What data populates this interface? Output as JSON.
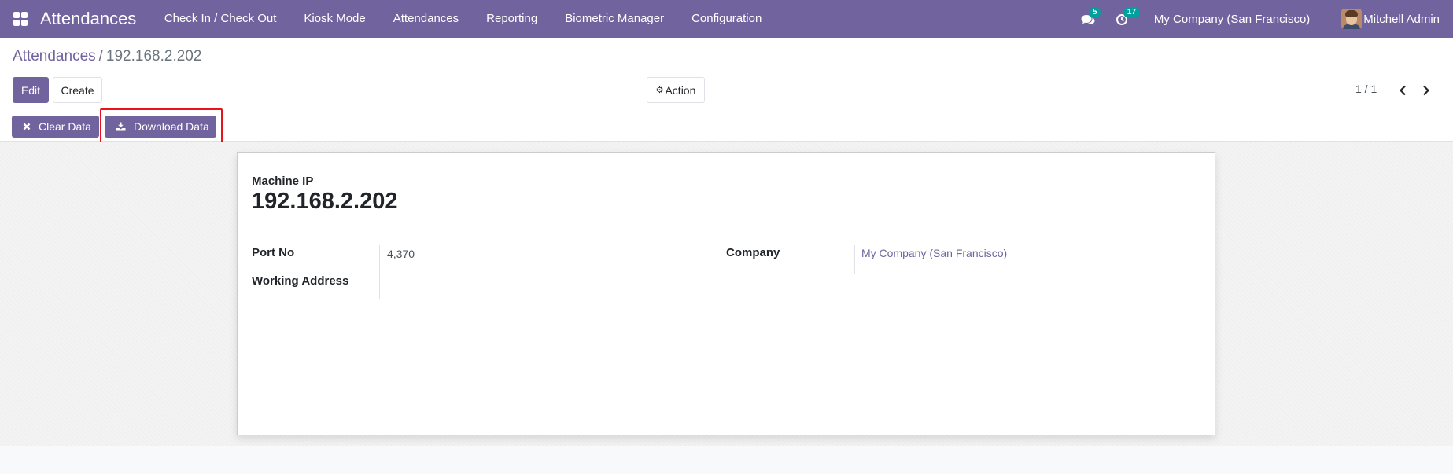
{
  "navbar": {
    "brand": "Attendances",
    "menu": [
      {
        "label": "Check In / Check Out"
      },
      {
        "label": "Kiosk Mode"
      },
      {
        "label": "Attendances"
      },
      {
        "label": "Reporting"
      },
      {
        "label": "Biometric Manager"
      },
      {
        "label": "Configuration"
      }
    ],
    "messages_badge": "5",
    "activities_badge": "17",
    "company": "My Company (San Francisco)",
    "user": "Mitchell Admin",
    "accent_color": "#71639e",
    "badge_color": "#00a09d"
  },
  "breadcrumb": {
    "parent": "Attendances",
    "separator": "/",
    "current": "192.168.2.202"
  },
  "buttons": {
    "edit": "Edit",
    "create": "Create",
    "action": "Action"
  },
  "pager": {
    "value": "1 / 1"
  },
  "statusbar": {
    "clear_data": "Clear Data",
    "download_data": "Download Data",
    "highlight_color": "#e8141c"
  },
  "form": {
    "machine_ip_label": "Machine IP",
    "machine_ip_value": "192.168.2.202",
    "port_label": "Port No",
    "port_value": "4,370",
    "working_address_label": "Working Address",
    "working_address_value": "",
    "company_label": "Company",
    "company_value": "My Company (San Francisco)"
  }
}
